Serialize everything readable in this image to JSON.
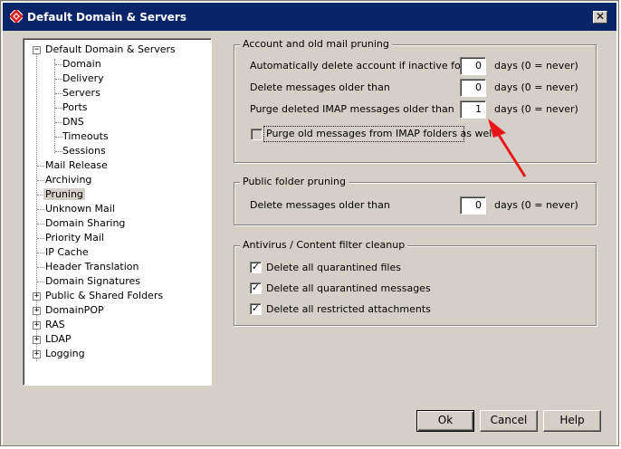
{
  "window": {
    "title": "Default Domain & Servers",
    "close_glyph": "✕"
  },
  "tree": {
    "root": "Default Domain & Servers",
    "children": [
      "Domain",
      "Delivery",
      "Servers",
      "Ports",
      "DNS",
      "Timeouts",
      "Sessions"
    ],
    "items": [
      "Mail Release",
      "Archiving",
      "Pruning",
      "Unknown Mail",
      "Domain Sharing",
      "Priority Mail",
      "IP Cache",
      "Header Translation",
      "Domain Signatures"
    ],
    "expandable": [
      "Public & Shared Folders",
      "DomainPOP",
      "RAS",
      "LDAP",
      "Logging"
    ],
    "selected": "Pruning"
  },
  "account_group": {
    "legend": "Account and old mail pruning",
    "rows": [
      {
        "label": "Automatically delete account if inactive for",
        "value": "0",
        "suffix": "days (0 = never)"
      },
      {
        "label": "Delete messages older than",
        "value": "0",
        "suffix": "days (0 = never)"
      },
      {
        "label": "Purge deleted IMAP messages older than",
        "value": "1",
        "suffix": "days (0 = never)"
      }
    ],
    "purge_checkbox": {
      "label": "Purge old messages from IMAP folders as well",
      "checked": false
    }
  },
  "public_group": {
    "legend": "Public folder pruning",
    "row": {
      "label": "Delete messages older than",
      "value": "0",
      "suffix": "days (0 = never)"
    }
  },
  "antivirus_group": {
    "legend": "Antivirus / Content filter cleanup",
    "items": [
      {
        "label": "Delete all quarantined files",
        "checked": true
      },
      {
        "label": "Delete all quarantined messages",
        "checked": true
      },
      {
        "label": "Delete all restricted attachments",
        "checked": true
      }
    ]
  },
  "buttons": {
    "ok": "Ok",
    "cancel": "Cancel",
    "help": "Help"
  },
  "colors": {
    "titlebar": "#0a246a",
    "arrow": "#e8161b",
    "face": "#d4d0c8"
  },
  "icons": {
    "app": "app-icon",
    "check": "✓",
    "expand": "+",
    "collapse": "−"
  }
}
